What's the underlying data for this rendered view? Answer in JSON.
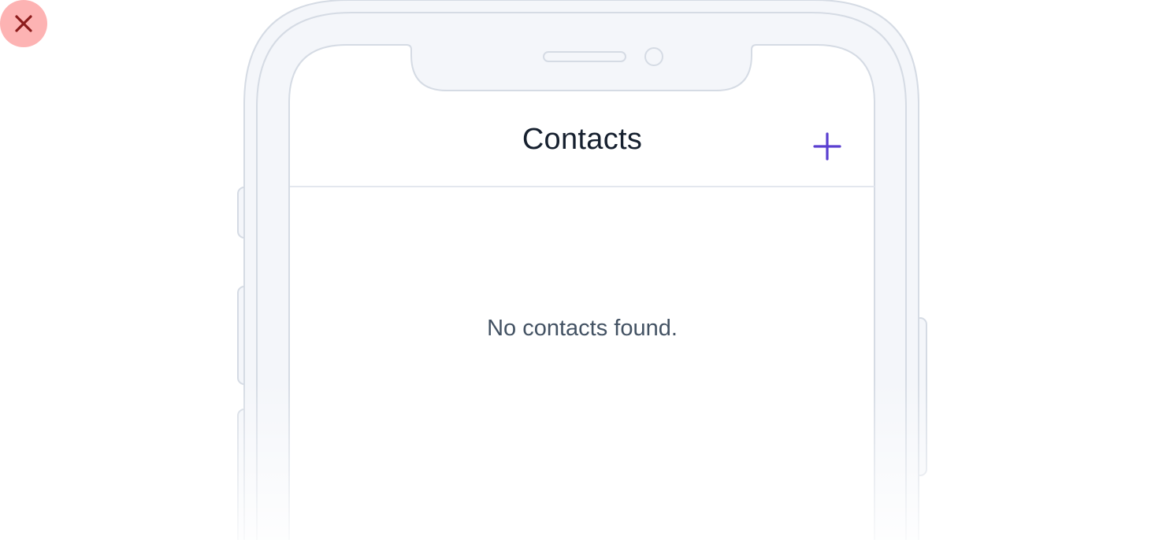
{
  "close": {
    "icon": "close-icon",
    "color": "#8c1c1c",
    "background": "#fdb3b3"
  },
  "screen": {
    "title": "Contacts",
    "add_icon": "plus-icon",
    "accent": "#5a3fd0",
    "empty_message": "No contacts found."
  },
  "device": {
    "frame_color": "#f4f6fa",
    "stroke_color": "#d5dbe4"
  }
}
